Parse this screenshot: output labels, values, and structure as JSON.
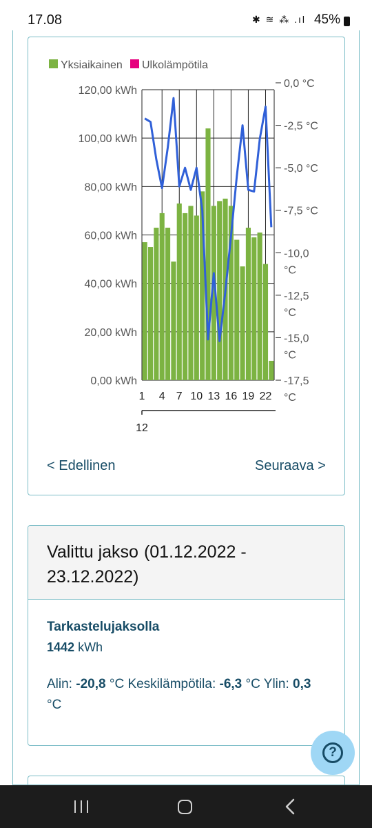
{
  "status": {
    "time": "17.08",
    "icons": "✱ ≋ ⁂ .ıl",
    "battery": "45%"
  },
  "chart_data": {
    "type": "bar",
    "series": [
      {
        "name": "Yksiaikainen",
        "color": "#7cb342",
        "kind": "bar",
        "axis": "left",
        "values": [
          57,
          55,
          63,
          69,
          63,
          49,
          73,
          69,
          72,
          68,
          78,
          104,
          72,
          74,
          75,
          72,
          58,
          47,
          63,
          59,
          61,
          48,
          8
        ]
      },
      {
        "name": "Ulkolämpötila",
        "color": "#e6007e",
        "line_color": "#3060d8",
        "kind": "line",
        "axis": "right",
        "values": [
          -2.1,
          -2.3,
          -4.5,
          -6.2,
          -3.8,
          -0.9,
          -6.1,
          -5.0,
          -6.3,
          -5.0,
          -7.5,
          -15.1,
          -11.2,
          -15.2,
          -12.3,
          -9.0,
          -5.5,
          -2.5,
          -6.3,
          -6.4,
          -3.3,
          -1.4,
          -8.5
        ]
      }
    ],
    "x": [
      1,
      2,
      3,
      4,
      5,
      6,
      7,
      8,
      9,
      10,
      11,
      12,
      13,
      14,
      15,
      16,
      17,
      18,
      19,
      20,
      21,
      22,
      23
    ],
    "x_tick_labels": [
      "1",
      "4",
      "7",
      "10",
      "13",
      "16",
      "19",
      "22"
    ],
    "x_tick_values": [
      1,
      4,
      7,
      10,
      13,
      16,
      19,
      22
    ],
    "x_group_label": "12",
    "y_left_ticks": [
      "120,00 kWh",
      "100,00 kWh",
      "80,00 kWh",
      "60,00 kWh",
      "40,00 kWh",
      "20,00 kWh",
      "0,00 kWh"
    ],
    "y_left_values": [
      120,
      100,
      80,
      60,
      40,
      20,
      0
    ],
    "ylim_left": [
      0,
      120
    ],
    "y_right_ticks": [
      [
        "0,0 °C"
      ],
      [
        "-2,5 °C"
      ],
      [
        "-5,0 °C"
      ],
      [
        "-7,5 °C"
      ],
      [
        "-10,0",
        "°C"
      ],
      [
        "-12,5",
        "°C"
      ],
      [
        "-15,0",
        "°C"
      ],
      [
        "-17,5",
        "°C"
      ]
    ],
    "y_right_values": [
      0,
      -2.5,
      -5,
      -7.5,
      -10,
      -12.5,
      -15,
      -17.5
    ],
    "ylim_right": [
      -17.5,
      0
    ],
    "grid": true,
    "legend": "top-left"
  },
  "nav": {
    "prev_label": "< Edellinen",
    "next_label": "Seuraava >"
  },
  "period": {
    "title": "Valittu jakso",
    "dates": "(01.12.2022 - 23.12.2022)",
    "sub_heading": "Tarkastelujaksolla",
    "total_value": "1442",
    "total_unit": "kWh",
    "min_label": "Alin:",
    "min_value": "-20,8",
    "avg_label": "°C Keskilämpötila:",
    "avg_value": "-6,3",
    "max_label": "°C Ylin:",
    "max_value": "0,3",
    "unit_c": "°C"
  },
  "help": {
    "icon": "question-circle",
    "glyph": "?"
  }
}
